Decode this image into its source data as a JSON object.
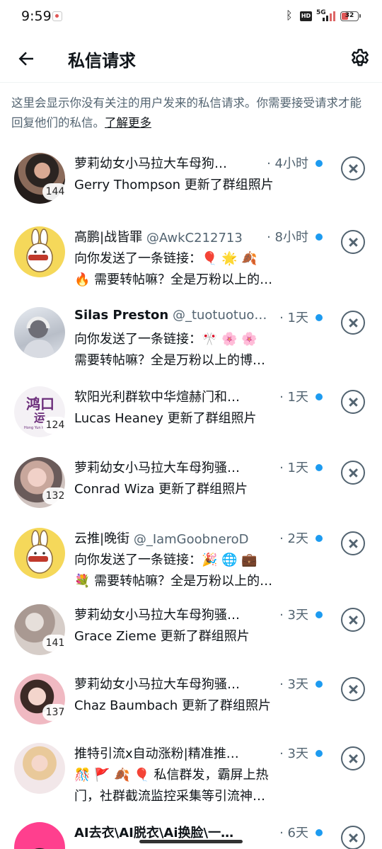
{
  "status_bar": {
    "time": "9:59",
    "network": "5G",
    "battery": "32"
  },
  "header": {
    "title": "私信请求"
  },
  "notice": {
    "text": "这里会显示你没有关注的用户发来的私信请求。你需要接受请求才能回复他们的私信。",
    "link": "了解更多"
  },
  "requests": [
    {
      "name": "萝莉幼女小马拉大车母狗…",
      "handle": "",
      "time": "· 4小时",
      "badge": "144",
      "preview1": "Gerry Thompson 更新了群组照片",
      "preview2": ""
    },
    {
      "name": "高鹏|战皆罪",
      "handle": "@AwkC212713",
      "time": "· 8小时",
      "badge": "",
      "preview1": "向你发送了一条链接：🎈 🌟 🍂",
      "preview2": "🔥 需要转帖嘛？全是万粉以上的…"
    },
    {
      "name": "Silas Preston",
      "handle": "@_tuotuotuo…",
      "time": "· 1天",
      "badge": "",
      "preview1": "向你发送了一条链接：🎌 🌸 🌸",
      "preview2": "需要转帖嘛？全是万粉以上的博…"
    },
    {
      "name": "软阳光利群软中华煊赫门和…",
      "handle": "",
      "time": "· 1天",
      "badge": "124",
      "preview1": "Lucas Heaney 更新了群组照片",
      "preview2": ""
    },
    {
      "name": "萝莉幼女小马拉大车母狗骚…",
      "handle": "",
      "time": "· 1天",
      "badge": "132",
      "preview1": "Conrad Wiza 更新了群组照片",
      "preview2": ""
    },
    {
      "name": "云推|晚街",
      "handle": "@_IamGoobneroD",
      "time": "· 2天",
      "badge": "",
      "preview1": "向你发送了一条链接：🎉 🌐 💼",
      "preview2": "💐 需要转帖嘛？全是万粉以上的…"
    },
    {
      "name": "萝莉幼女小马拉大车母狗骚…",
      "handle": "",
      "time": "· 3天",
      "badge": "141",
      "preview1": "Grace Zieme 更新了群组照片",
      "preview2": ""
    },
    {
      "name": "萝莉幼女小马拉大车母狗骚…",
      "handle": "",
      "time": "· 3天",
      "badge": "137",
      "preview1": "Chaz Baumbach 更新了群组照片",
      "preview2": ""
    },
    {
      "name": "推特引流x自动涨粉|精准推…",
      "handle": "",
      "time": "· 3天",
      "badge": "",
      "preview1": "🎊 🚩 🍂 🎈 私信群发，霸屏上热",
      "preview2": "门，社群截流监控采集等引流神…"
    },
    {
      "name": "AI去衣\\AI脱衣\\Ai换脸\\一…",
      "handle": "",
      "time": "· 6天",
      "badge": "",
      "preview1": "",
      "preview2": ""
    }
  ],
  "avatar_logo": {
    "text_top": "鸿口",
    "text_mid": "运",
    "text_small": "Hong Yun Kou Liang"
  },
  "colors": {
    "accent": "#1d9bf0",
    "text": "#0f1419",
    "muted": "#536471"
  }
}
